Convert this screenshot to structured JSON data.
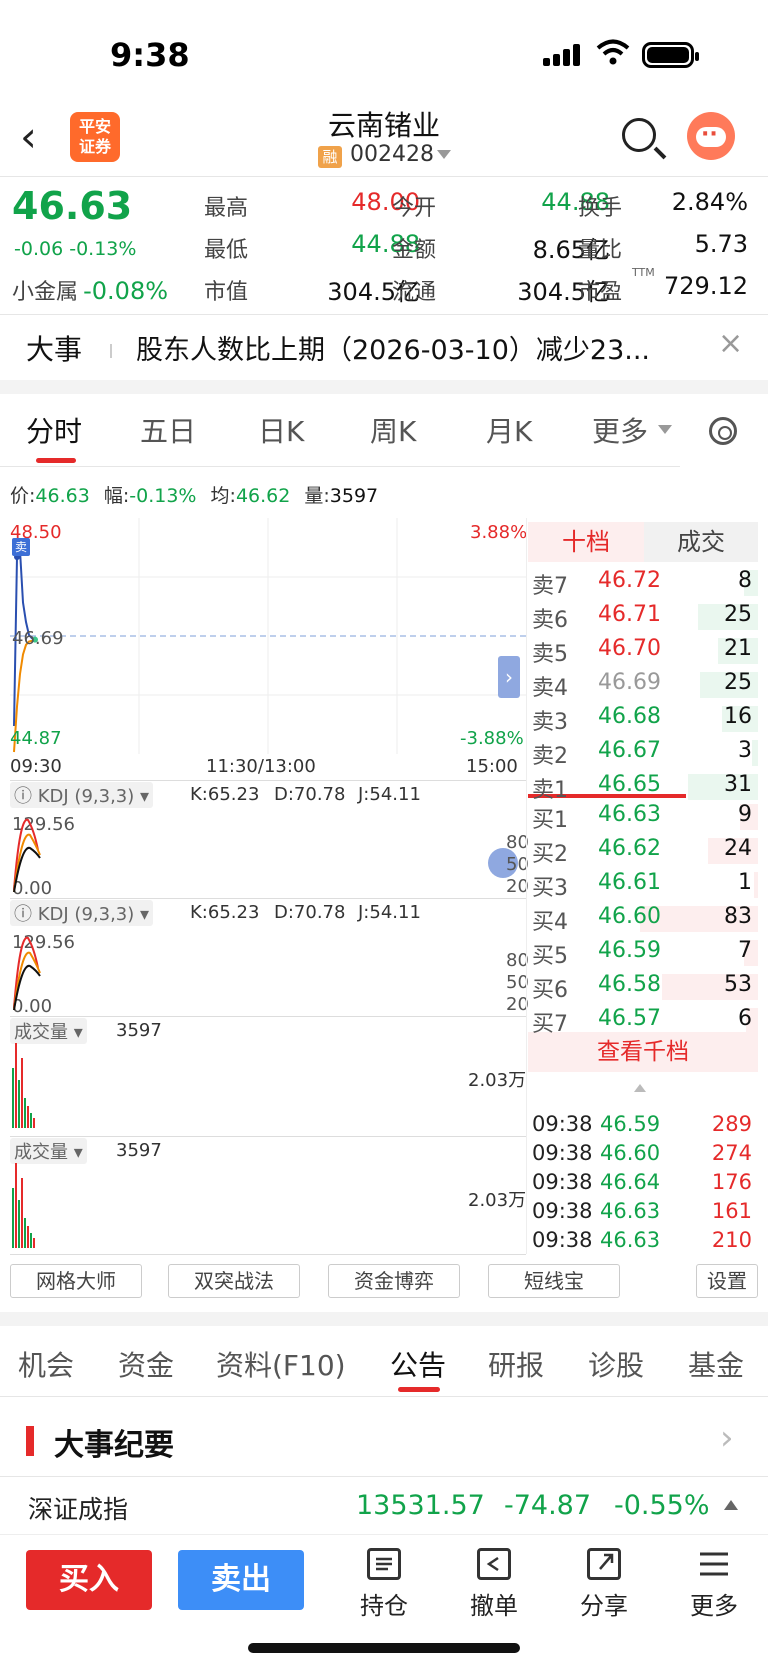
{
  "status": {
    "time": "9:38"
  },
  "nav": {
    "title": "云南锗业",
    "rong": "融",
    "code": "002428",
    "logo_line1": "平安",
    "logo_line2": "证券"
  },
  "quote": {
    "price": "46.63",
    "change": "-0.06",
    "change_pct": "-0.13%",
    "sector_label": "小金属",
    "sector_pct": "-0.08%",
    "rows": [
      {
        "l1": "最高",
        "v1": "48.00",
        "l2": "今开",
        "v2": "44.88",
        "l3": "换手",
        "v3": "2.84%"
      },
      {
        "l1": "最低",
        "v1": "44.88",
        "l2": "金额",
        "v2": "8.65亿",
        "l3": "量比",
        "v3": "5.73"
      },
      {
        "l1": "市值",
        "v1": "304.5亿",
        "l2": "流通",
        "v2": "304.5亿",
        "l3": "市盈",
        "v3": "729.12"
      }
    ],
    "ttm": "TTM"
  },
  "event": {
    "tag": "大事",
    "text": "股东人数比上期（2026-03-10）减少23..."
  },
  "chart_tabs": [
    "分时",
    "五日",
    "日K",
    "周K",
    "月K",
    "更多"
  ],
  "info": {
    "p_label": "价:",
    "p": "46.63",
    "f_label": "幅:",
    "f": "-0.13%",
    "j_label": "均:",
    "j": "46.62",
    "v_label": "量:",
    "v": "3597"
  },
  "chart_data": {
    "type": "line",
    "title": "",
    "ylim": [
      44.87,
      48.5
    ],
    "y_top_label": "48.50",
    "y_mid_label": "46.69",
    "y_bot_label": "44.87",
    "pct_top": "3.88%",
    "pct_bot": "-3.88%",
    "x_ticks": [
      "09:30",
      "11:30/13:00",
      "15:00"
    ],
    "sell_tag": "卖",
    "series": [
      {
        "values": [
          45.3,
          47.9,
          48.0,
          47.2,
          46.9,
          46.7,
          46.65,
          46.63
        ]
      },
      {
        "values": [
          44.9,
          45.6,
          46.1,
          46.4,
          46.55,
          46.6,
          46.61,
          46.62
        ]
      }
    ]
  },
  "kdj": {
    "name": "KDJ (9,3,3)",
    "k": "K:65.23",
    "d": "D:70.78",
    "j": "J:54.11",
    "max": "129.56",
    "min": "0.00",
    "levels": [
      "80",
      "50",
      "20"
    ]
  },
  "volume": {
    "name": "成交量",
    "value": "3597",
    "max": "2.03万"
  },
  "orderbook": {
    "tabs": [
      "十档",
      "成交"
    ],
    "sells": [
      {
        "n": "卖7",
        "p": "46.72",
        "v": "8",
        "pc": "red"
      },
      {
        "n": "卖6",
        "p": "46.71",
        "v": "25",
        "pc": "red"
      },
      {
        "n": "卖5",
        "p": "46.70",
        "v": "21",
        "pc": "red"
      },
      {
        "n": "卖4",
        "p": "46.69",
        "v": "25",
        "pc": "gray"
      },
      {
        "n": "卖3",
        "p": "46.68",
        "v": "16",
        "pc": "green"
      },
      {
        "n": "卖2",
        "p": "46.67",
        "v": "3",
        "pc": "green"
      },
      {
        "n": "卖1",
        "p": "46.65",
        "v": "31",
        "pc": "green"
      }
    ],
    "buys": [
      {
        "n": "买1",
        "p": "46.63",
        "v": "9"
      },
      {
        "n": "买2",
        "p": "46.62",
        "v": "24"
      },
      {
        "n": "买3",
        "p": "46.61",
        "v": "1"
      },
      {
        "n": "买4",
        "p": "46.60",
        "v": "83"
      },
      {
        "n": "买5",
        "p": "46.59",
        "v": "7"
      },
      {
        "n": "买6",
        "p": "46.58",
        "v": "53"
      },
      {
        "n": "买7",
        "p": "46.57",
        "v": "6"
      }
    ],
    "view_all": "查看千档",
    "ticks": [
      {
        "t": "09:38",
        "p": "46.59",
        "v": "289"
      },
      {
        "t": "09:38",
        "p": "46.60",
        "v": "274"
      },
      {
        "t": "09:38",
        "p": "46.64",
        "v": "176"
      },
      {
        "t": "09:38",
        "p": "46.63",
        "v": "161"
      },
      {
        "t": "09:38",
        "p": "46.63",
        "v": "210"
      }
    ]
  },
  "tools": [
    "网格大师",
    "双突战法",
    "资金博弈",
    "短线宝",
    "设置"
  ],
  "bottom_tabs": [
    "机会",
    "资金",
    "资料(F10)",
    "公告",
    "研报",
    "诊股",
    "基金"
  ],
  "section": {
    "title": "大事纪要"
  },
  "index": {
    "name": "深证成指",
    "value": "13531.57",
    "change": "-74.87",
    "pct": "-0.55%"
  },
  "actions": {
    "buy": "买入",
    "sell": "卖出",
    "items": [
      "持仓",
      "撤单",
      "分享",
      "更多"
    ]
  }
}
